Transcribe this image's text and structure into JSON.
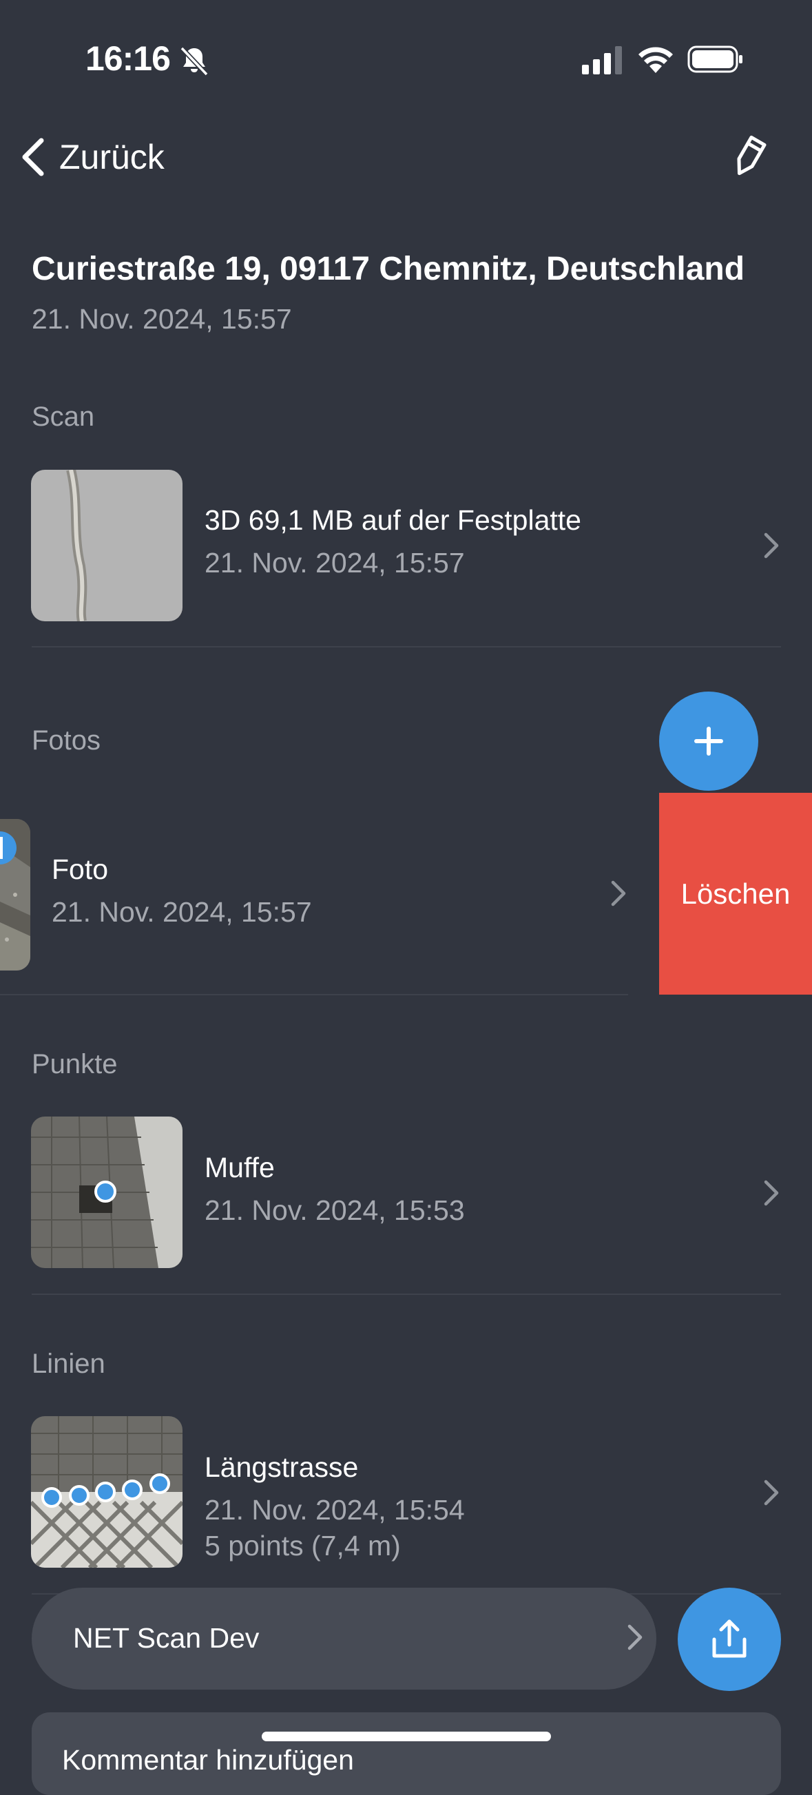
{
  "status_bar": {
    "time": "16:16"
  },
  "nav": {
    "back_label": "Zurück"
  },
  "header": {
    "title": "Curiestraße 19, 09117 Chemnitz, Deutschland",
    "date": "21. Nov. 2024, 15:57"
  },
  "sections": {
    "scan": "Scan",
    "fotos": "Fotos",
    "punkte": "Punkte",
    "linien": "Linien"
  },
  "scan_item": {
    "title": "3D 69,1 MB auf der Festplatte",
    "date": "21. Nov. 2024, 15:57"
  },
  "foto_item": {
    "title": "Foto",
    "date": "21. Nov. 2024, 15:57",
    "delete_label": "Löschen"
  },
  "punkt_item": {
    "title": "Muffe",
    "date": "21. Nov. 2024, 15:53"
  },
  "linie_item": {
    "title": "Längstrasse",
    "date": "21. Nov. 2024, 15:54",
    "detail": "5 points (7,4 m)"
  },
  "bottom": {
    "project_label": "NET Scan Dev",
    "comment_placeholder": "Kommentar hinzufügen"
  },
  "colors": {
    "accent": "#3f96e2",
    "delete": "#e84f43",
    "background": "#31353f"
  }
}
